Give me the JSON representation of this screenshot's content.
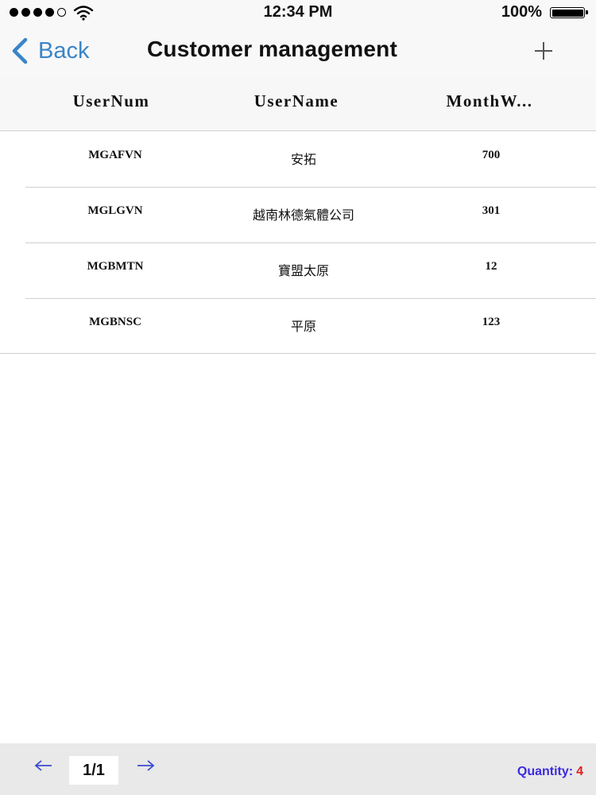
{
  "status_bar": {
    "time": "12:34 PM",
    "battery": "100%",
    "icons": [
      "signal-dots-icon",
      "wifi-icon",
      "battery-icon"
    ]
  },
  "nav": {
    "back_label": "Back",
    "title": "Customer management",
    "icons": [
      "back-chevron-icon",
      "plus-icon"
    ],
    "accent_color": "#3a85c8"
  },
  "table": {
    "columns": [
      "UserNum",
      "UserName",
      "MonthW..."
    ],
    "rows": [
      {
        "user_num": "MGAFVN",
        "user_name": "安拓",
        "month_w": "700"
      },
      {
        "user_num": "MGLGVN",
        "user_name": "越南林德氣體公司",
        "month_w": "301"
      },
      {
        "user_num": "MGBMTN",
        "user_name": "寶盟太原",
        "month_w": "12"
      },
      {
        "user_num": "MGBNSC",
        "user_name": "平原",
        "month_w": "123"
      }
    ]
  },
  "toolbar": {
    "page": "1/1",
    "quantity_label": "Quantity:",
    "quantity_value": "4",
    "icons": [
      "arrow-left-icon",
      "arrow-right-icon"
    ],
    "quantity_label_color": "#3b2be0",
    "quantity_value_color": "#e02020"
  }
}
